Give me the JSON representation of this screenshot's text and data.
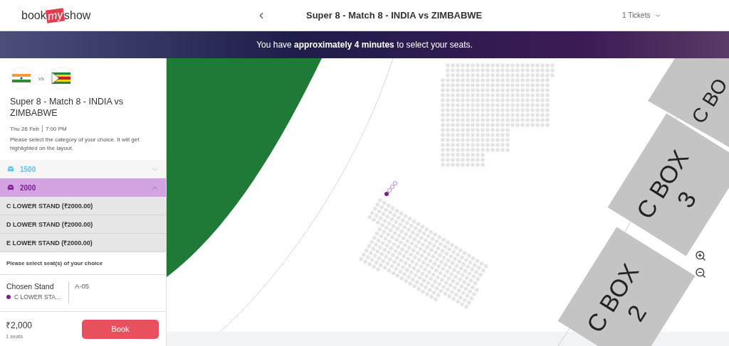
{
  "header": {
    "logo_left": "book",
    "logo_mid": "my",
    "logo_right": "show",
    "title": "Super 8 - Match 8 - INDIA vs ZIMBABWE",
    "tickets": "1 Tickets"
  },
  "banner": "You have **approximately 4 minutes** to select your seats.",
  "event": {
    "vs": "vs",
    "title": "Super 8 - Match 8 - INDIA vs ZIMBABWE",
    "date": "Thu 26 Feb",
    "time": "7:00 PM",
    "note": "Please select the category of your choice. It will get highlighted on the layout."
  },
  "categories": [
    {
      "label": "1500",
      "expanded": false,
      "color": "#5bc4ec"
    },
    {
      "label": "2000",
      "expanded": true,
      "color": "#7b1e8e",
      "stands": [
        "C LOWER STAND (₹2000.00)",
        "D LOWER STAND (₹2000.00)",
        "E LOWER STAND (₹2000.00)"
      ]
    }
  ],
  "prompt": "Please select seat(s) of your choice",
  "chosen": {
    "label": "Chosen Stand",
    "stand": "C LOWER STA...",
    "seat": "A-05"
  },
  "footer": {
    "price": "₹2,000",
    "seats": "1 seats",
    "button": "Book"
  },
  "map": {
    "boxes": [
      {
        "line1": "C BO"
      },
      {
        "line1": "C BOX",
        "line2": "3"
      },
      {
        "line1": "C BOX",
        "line2": "2"
      }
    ]
  }
}
